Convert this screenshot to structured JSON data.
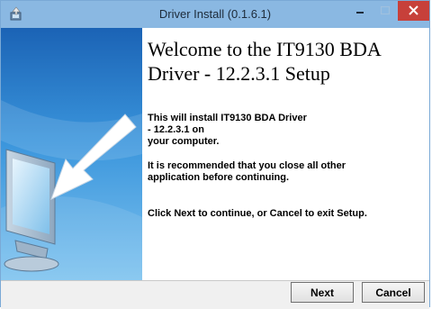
{
  "window": {
    "title": "Driver Install (0.1.6.1)"
  },
  "welcome": {
    "heading": "Welcome to the IT9130 BDA Driver - 12.2.3.1 Setup",
    "para1_line1": "This will install IT9130 BDA Driver",
    "para1_line2": "- 12.2.3.1 on",
    "para1_line3": "your computer.",
    "para2_line1": "It is recommended that you close all other",
    "para2_line2": "application before continuing.",
    "para3": "Click Next to continue, or Cancel to exit Setup."
  },
  "buttons": {
    "next": "Next",
    "cancel": "Cancel"
  },
  "icons": {
    "app": "installer-icon",
    "minimize": "minimize-icon",
    "maximize": "maximize-icon",
    "close": "close-icon",
    "sidebar": "monitor-arrow-illustration"
  },
  "colors": {
    "titlebar": "#8ab8e2",
    "close": "#c7403a",
    "sidebar": "#2e7fc8"
  }
}
